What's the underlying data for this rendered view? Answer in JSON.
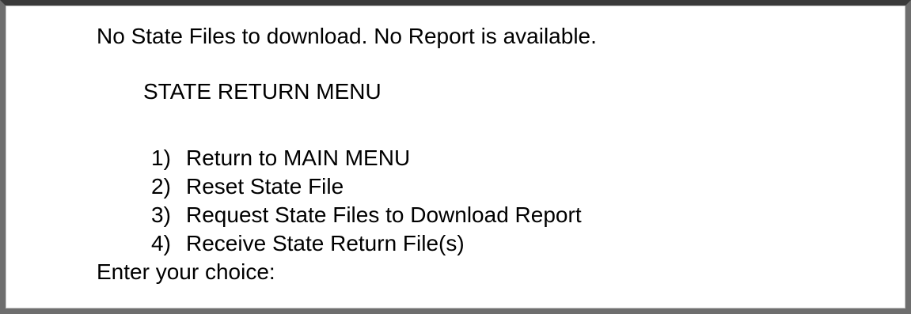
{
  "screen": {
    "status_message": "No State Files to download. No Report is available.",
    "menu_title": "STATE RETURN MENU",
    "menu_items": [
      {
        "number": "1)",
        "label": "Return to MAIN MENU"
      },
      {
        "number": "2)",
        "label": "Reset State File"
      },
      {
        "number": "3)",
        "label": "Request State Files to Download Report"
      },
      {
        "number": "4)",
        "label": "Receive State Return File(s)"
      }
    ],
    "prompt": "Enter your choice:",
    "choice_value": ""
  }
}
